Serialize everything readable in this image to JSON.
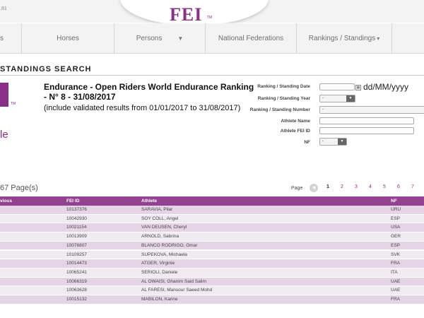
{
  "top_bar": {
    "ip_text": ".81"
  },
  "logo": {
    "text": "FEI",
    "tm": "TM"
  },
  "nav": {
    "items": [
      {
        "label": "s"
      },
      {
        "label": "Horses"
      },
      {
        "label": "Persons",
        "has_dropdown": true
      },
      {
        "label": "National Federations"
      },
      {
        "label": "Rankings / Standings",
        "has_dropdown": true
      }
    ]
  },
  "section_title": "STANDINGS SEARCH",
  "emblem": {
    "tm": "TM",
    "partial_text": "le"
  },
  "ranking": {
    "title": "Endurance - Open Riders World Endurance Ranking - N° 8 - 31/08/2017",
    "subtitle": "(include validated results from 01/01/2017 to 31/08/2017)"
  },
  "form": {
    "date_label": "Ranking / Standing Date",
    "date_value": "",
    "date_hint": "dd/MM/yyyy",
    "year_label": "Ranking / Standing Year",
    "year_value": "-",
    "number_label": "Ranking / Standing Number",
    "number_value": "-",
    "athlete_name_label": "Athlete Name",
    "athlete_name_value": "",
    "athlete_id_label": "Athlete FEI ID",
    "athlete_id_value": "",
    "nf_label": "NF",
    "nf_value": "-"
  },
  "pagination": {
    "pages_text": "67 Page(s)",
    "page_label": "Page",
    "prev_icon": "chevron-left-icon",
    "pages": [
      "1",
      "2",
      "3",
      "4",
      "5",
      "6",
      "7"
    ],
    "current": "1"
  },
  "table": {
    "columns": [
      "vious",
      "FEI ID",
      "Athlete",
      "NF"
    ],
    "rows": [
      {
        "fei_id": "10137376",
        "athlete": "SARAVIA, Pilar",
        "nf": "URU"
      },
      {
        "fei_id": "10042930",
        "athlete": "SOY COLL, Angel",
        "nf": "ESP"
      },
      {
        "fei_id": "10021154",
        "athlete": "VAN DEUSEN, Cheryl",
        "nf": "USA"
      },
      {
        "fei_id": "10013909",
        "athlete": "ARNOLD, Sabrina",
        "nf": "GER"
      },
      {
        "fei_id": "10076807",
        "athlete": "BLANCO RODRIGO, Omar",
        "nf": "ESP"
      },
      {
        "fei_id": "10109257",
        "athlete": "SUPEKOVA, Michaela",
        "nf": "SVK"
      },
      {
        "fei_id": "10014473",
        "athlete": "ATGER, Virginie",
        "nf": "FRA"
      },
      {
        "fei_id": "10065241",
        "athlete": "SERIOLI, Daniele",
        "nf": "ITA"
      },
      {
        "fei_id": "10066319",
        "athlete": "AL OWAISI, Ghanim Said Salim",
        "nf": "UAE"
      },
      {
        "fei_id": "10063628",
        "athlete": "AL FARESI, Mansour Saeed Mohd",
        "nf": "UAE"
      },
      {
        "fei_id": "10015132",
        "athlete": "MABILON, Karine",
        "nf": "FRA"
      }
    ]
  },
  "colors": {
    "brand": "#8a2f86",
    "table_header": "#934291",
    "row_odd": "#e4d4e6",
    "row_even": "#f2eaf3"
  }
}
